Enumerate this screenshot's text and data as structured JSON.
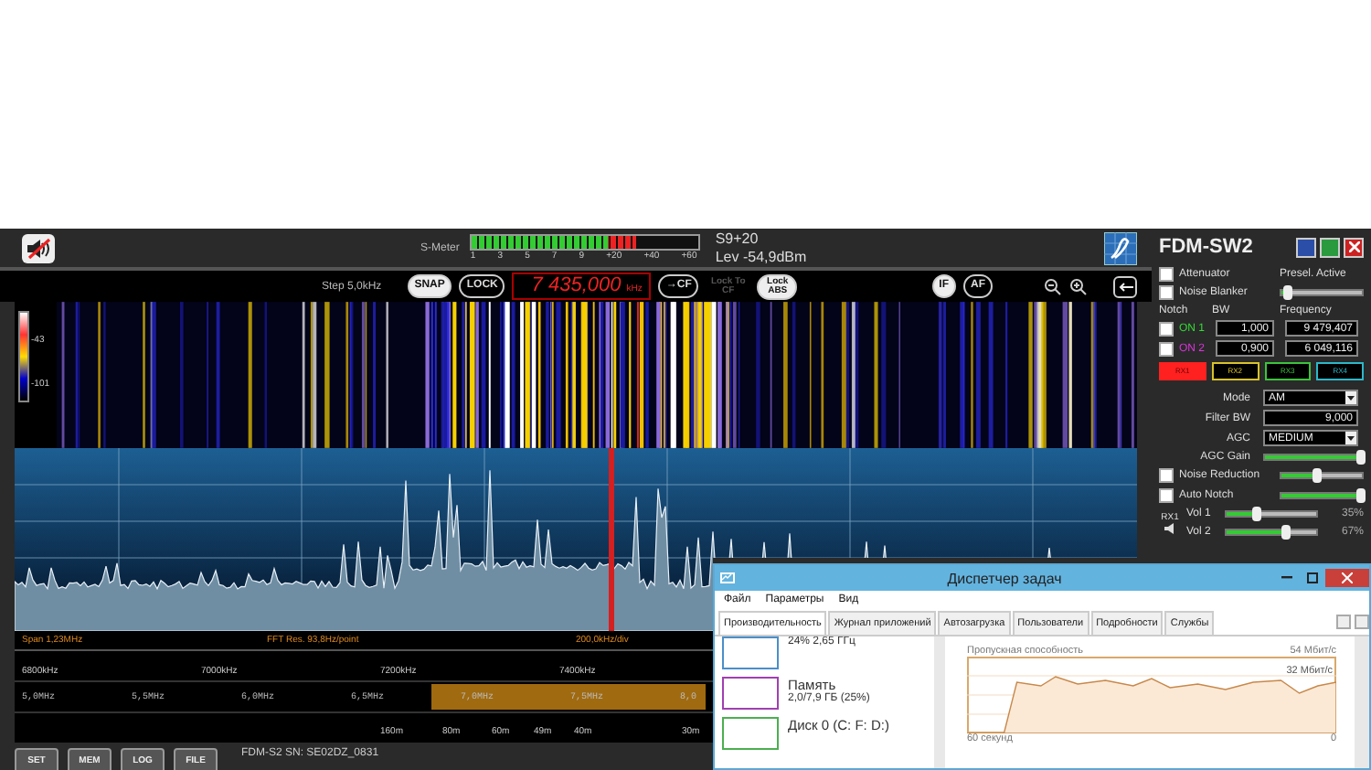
{
  "top_bar": {
    "s_meter": {
      "label": "S-Meter",
      "level": 0.72,
      "scale": [
        "1",
        "3",
        "5",
        "7",
        "9",
        "+20",
        "+40",
        "+60"
      ]
    },
    "signal": "S9+20",
    "level_reading": "Lev -54,9dBm"
  },
  "toolbar": {
    "step": "Step 5,0kHz",
    "buttons": [
      {
        "label": "SNAP",
        "selected": true
      },
      {
        "label": "LOCK",
        "selected": false
      }
    ],
    "frequency": "7 435,000",
    "unit": "kHz",
    "cf_button": "→CF",
    "locks": [
      {
        "label": "Lock To CF",
        "disabled": true
      },
      {
        "label": "Lock ABS",
        "disabled": false
      }
    ],
    "modes": [
      {
        "label": "IF",
        "selected": true
      },
      {
        "label": "AF",
        "selected": false
      }
    ]
  },
  "waterfall": {
    "scale_labels": [
      "-43",
      "-101"
    ]
  },
  "spectrum": {
    "info": [
      "Span 1,23MHz",
      "FFT Res. 93,8Hz/point",
      "200,0kHz/div"
    ]
  },
  "frequency_scale": [
    "6800kHz",
    "7000kHz",
    "7200kHz",
    "7400kHz"
  ],
  "band_scale": [
    "5,0MHz",
    "5,5MHz",
    "6,0MHz",
    "6,5MHz",
    "7,0MHz",
    "7,5MHz",
    "8,0"
  ],
  "meter_bands": [
    "160m",
    "80m",
    "60m",
    "49m",
    "40m",
    "30m"
  ],
  "bottom_bar": {
    "buttons": [
      "SET",
      "MEM",
      "LOG",
      "FILE"
    ],
    "device": "FDM-S2 SN: SE02DZ_0831"
  },
  "panel": {
    "title": "FDM-SW2",
    "attenuator": {
      "label": "Attenuator",
      "checked": false
    },
    "presel": {
      "label": "Presel. Active",
      "level": 0.1
    },
    "noise_blanker": {
      "label": "Noise Blanker",
      "checked": false
    },
    "notch_headers": [
      "Notch",
      "BW",
      "Frequency"
    ],
    "notches": [
      {
        "label": "ON 1",
        "checked": false,
        "color": "#33dd33",
        "bw": "1,000",
        "frequency": "9 479,407"
      },
      {
        "label": "ON 2",
        "checked": false,
        "color": "#dd33dd",
        "bw": "0,900",
        "frequency": "6 049,116"
      }
    ],
    "receivers": [
      {
        "label": "RX1",
        "selected": true,
        "color": "#ff2020"
      },
      {
        "label": "RX2",
        "selected": false,
        "color": "#d8c22a"
      },
      {
        "label": "RX3",
        "selected": false,
        "color": "#3cc43c"
      },
      {
        "label": "RX4",
        "selected": false,
        "color": "#2cb8c8"
      }
    ],
    "settings": [
      {
        "kind": "dropdown",
        "label": "Mode",
        "value": "AM"
      },
      {
        "kind": "spin",
        "label": "Filter BW",
        "value": "9,000"
      },
      {
        "kind": "dropdown",
        "label": "AGC",
        "value": "MEDIUM"
      },
      {
        "kind": "slider",
        "label": "AGC Gain",
        "level": 1.0
      }
    ],
    "toggles": [
      {
        "label": "Noise Reduction",
        "checked": false,
        "level": 0.45
      },
      {
        "label": "Auto Notch",
        "checked": false,
        "level": 1.0
      }
    ],
    "rx_label": "RX1",
    "volumes": [
      {
        "label": "Vol 1",
        "level": 0.35,
        "reading": "35%"
      },
      {
        "label": "Vol 2",
        "level": 0.67,
        "reading": "67%"
      }
    ]
  },
  "task_manager": {
    "title": "Диспетчер задач",
    "menu": [
      "Файл",
      "Параметры",
      "Вид"
    ],
    "tabs": [
      {
        "label": "Производительность",
        "selected": true
      },
      {
        "label": "Журнал приложений",
        "selected": false
      },
      {
        "label": "Автозагрузка",
        "selected": false
      },
      {
        "label": "Пользователи",
        "selected": false
      },
      {
        "label": "Подробности",
        "selected": false
      },
      {
        "label": "Службы",
        "selected": false
      }
    ],
    "resources": [
      {
        "detail": "24% 2,65 ГГц",
        "color": "#4a8fc9"
      },
      {
        "title": "Память",
        "detail": "2,0/7,9 ГБ (25%)",
        "color": "#a040b0"
      },
      {
        "title": "Диск 0 (C: F: D:)",
        "color": "#4caf50"
      }
    ],
    "chart": {
      "title": "Пропускная способность",
      "max": "54 Мбит/с",
      "current": "32 Мбит/с",
      "time_span": "60 секунд",
      "time_end": "0"
    }
  }
}
